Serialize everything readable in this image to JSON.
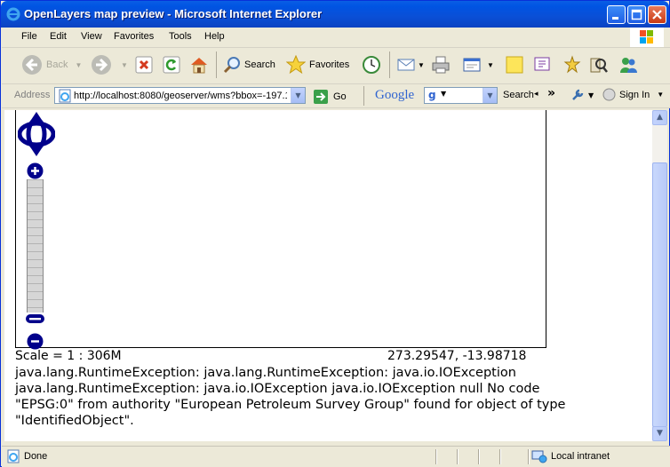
{
  "window": {
    "title": "OpenLayers map preview - Microsoft Internet Explorer"
  },
  "menu": [
    "File",
    "Edit",
    "View",
    "Favorites",
    "Tools",
    "Help"
  ],
  "toolbar": {
    "back_label": "Back",
    "search_label": "Search",
    "favorites_label": "Favorites"
  },
  "address": {
    "label": "Address",
    "url": "http://localhost:8080/geoserver/wms?bbox=-197.1",
    "go_label": "Go"
  },
  "google_bar": {
    "logo": "Google",
    "search_label": "Search",
    "overflow": "»",
    "signin_label": "Sign In"
  },
  "map": {
    "scale_text": "Scale = 1 : 306M",
    "coords_text": "273.29547, -13.98718"
  },
  "error": {
    "lines": [
      "java.lang.RuntimeException: java.lang.RuntimeException: java.io.IOException",
      "java.lang.RuntimeException: java.io.IOException java.io.IOException null No code",
      "\"EPSG:0\" from authority \"European Petroleum Survey Group\" found for object of type",
      "\"IdentifiedObject\"."
    ]
  },
  "status": {
    "text": "Done",
    "zone": "Local intranet"
  },
  "colors": {
    "title_bar": "#0054e3",
    "map_controls": "#00008b",
    "chrome": "#ece9d8"
  }
}
